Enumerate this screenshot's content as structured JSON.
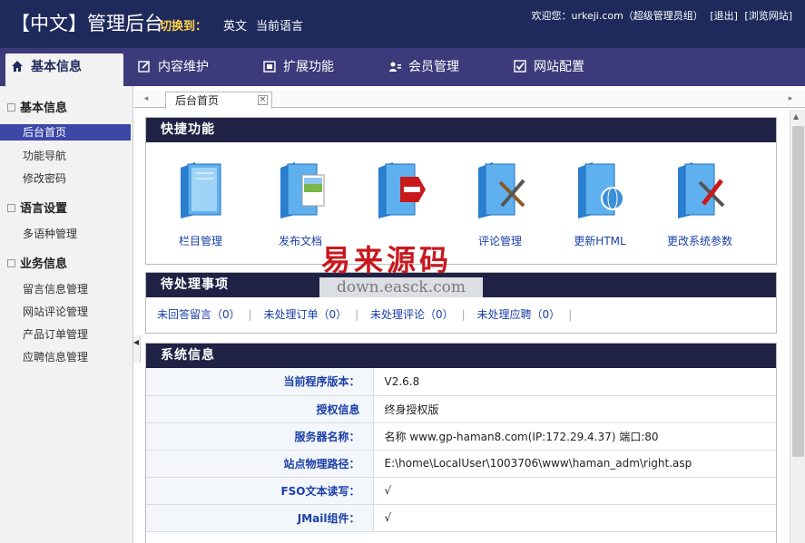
{
  "header": {
    "title": "【中文】管理后台",
    "switch_label": "切换到：",
    "lang_en": "英文",
    "lang_current": "当前语言",
    "welcome": "欢迎您：urkeji.com（超级管理员组）",
    "logout": "[退出]",
    "browse": "[浏览网站]"
  },
  "nav": {
    "tabs": [
      {
        "label": "基本信息"
      },
      {
        "label": "内容维护"
      },
      {
        "label": "扩展功能"
      },
      {
        "label": "会员管理"
      },
      {
        "label": "网站配置"
      }
    ]
  },
  "sidebar": {
    "groups": [
      {
        "label": "基本信息",
        "items": [
          "后台首页",
          "功能导航",
          "修改密码"
        ]
      },
      {
        "label": "语言设置",
        "items": [
          "多语种管理"
        ]
      },
      {
        "label": "业务信息",
        "items": [
          "留言信息管理",
          "网站评论管理",
          "产品订单管理",
          "应聘信息管理"
        ]
      }
    ]
  },
  "content_tab": {
    "label": "后台首页",
    "close": "×"
  },
  "quick": {
    "title": "快捷功能",
    "items": [
      {
        "label": "栏目管理",
        "icon": "folder-book-icon"
      },
      {
        "label": "发布文档",
        "icon": "folder-image-icon"
      },
      {
        "label": "",
        "icon": "folder-stop-icon"
      },
      {
        "label": "评论管理",
        "icon": "folder-tools-icon"
      },
      {
        "label": "更新HTML",
        "icon": "folder-globe-icon"
      },
      {
        "label": "更改系统参数",
        "icon": "folder-wrench-icon"
      }
    ]
  },
  "pending": {
    "title": "待处理事项",
    "items": [
      "未回答留言（0）",
      "未处理订单（0）",
      "未处理评论（0）",
      "未处理应聘（0）"
    ]
  },
  "sysinfo": {
    "title": "系统信息",
    "rows": [
      {
        "key": "当前程序版本：",
        "value": "V2.6.8"
      },
      {
        "key": "授权信息",
        "value": "终身授权版"
      },
      {
        "key": "服务器名称：",
        "value": "名称 www.gp-haman8.com(IP:172.29.4.37) 端口:80"
      },
      {
        "key": "站点物理路径：",
        "value": "E:\\home\\LocalUser\\1003706\\www\\haman_adm\\right.asp"
      },
      {
        "key": "FSO文本读写：",
        "value": "√"
      },
      {
        "key": "JMail组件：",
        "value": "√"
      }
    ]
  },
  "watermark": {
    "big": "易来源码",
    "small": "down.easck.com"
  },
  "colors": {
    "header_bg": "#1f2a5c",
    "nav_bg": "#3c3a7a",
    "panel_head": "#1f2244",
    "link": "#1a3fa8",
    "active": "#3c47a8"
  }
}
